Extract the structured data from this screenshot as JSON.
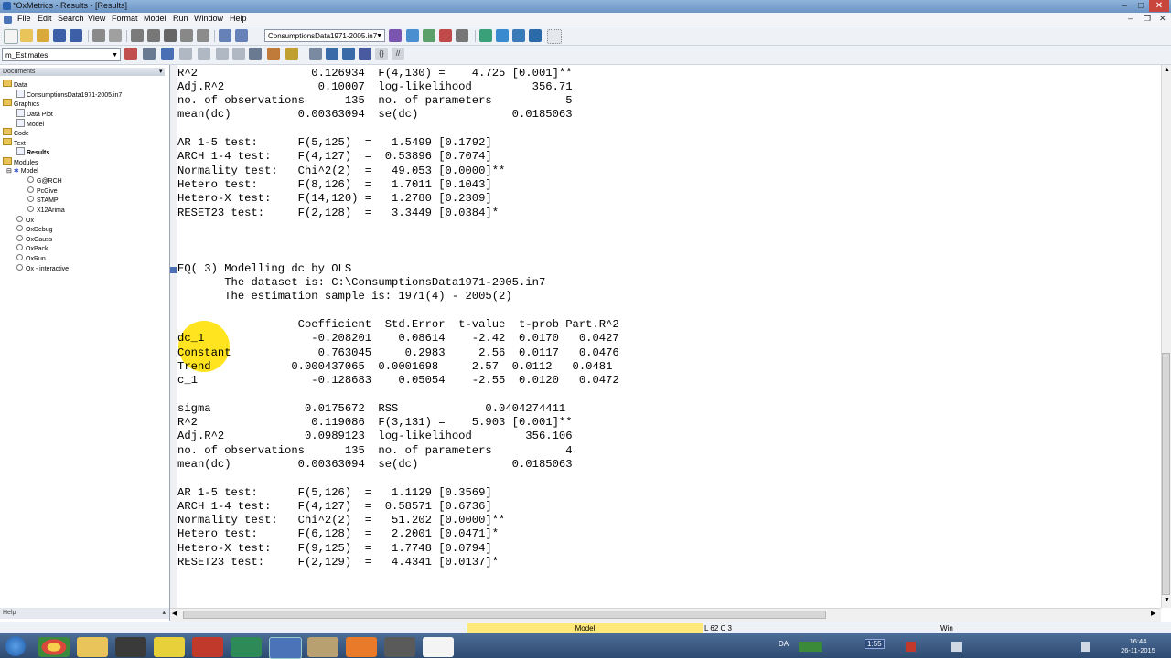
{
  "window": {
    "title": "*OxMetrics - Results - [Results]"
  },
  "menu": [
    "File",
    "Edit",
    "Search",
    "View",
    "Format",
    "Model",
    "Run",
    "Window",
    "Help"
  ],
  "toolbar": {
    "database_combo": "ConsumptionsData1971-2005.in7",
    "module_combo": "m_Estimates"
  },
  "sidebar": {
    "header": "Documents",
    "items": [
      {
        "label": "Data",
        "level": 0,
        "kind": "folder"
      },
      {
        "label": "ConsumptionsData1971-2005.in7",
        "level": 1,
        "kind": "file"
      },
      {
        "label": "Graphics",
        "level": 0,
        "kind": "folder"
      },
      {
        "label": "Data Plot",
        "level": 1,
        "kind": "file"
      },
      {
        "label": "Model",
        "level": 1,
        "kind": "file"
      },
      {
        "label": "Code",
        "level": 0,
        "kind": "folder"
      },
      {
        "label": "Text",
        "level": 0,
        "kind": "folder"
      },
      {
        "label": "Results",
        "level": 1,
        "kind": "file-bold"
      },
      {
        "label": "Modules",
        "level": 0,
        "kind": "folder"
      },
      {
        "label": "Model",
        "level": 1,
        "kind": "module"
      },
      {
        "label": "G@RCH",
        "level": 2,
        "kind": "sub"
      },
      {
        "label": "PcGive",
        "level": 2,
        "kind": "sub"
      },
      {
        "label": "STAMP",
        "level": 2,
        "kind": "sub"
      },
      {
        "label": "X12Arima",
        "level": 2,
        "kind": "sub"
      },
      {
        "label": "Ox",
        "level": 1,
        "kind": "sub"
      },
      {
        "label": "OxDebug",
        "level": 1,
        "kind": "sub"
      },
      {
        "label": "OxGauss",
        "level": 1,
        "kind": "sub"
      },
      {
        "label": "OxPack",
        "level": 1,
        "kind": "sub"
      },
      {
        "label": "OxRun",
        "level": 1,
        "kind": "sub"
      },
      {
        "label": "Ox - interactive",
        "level": 1,
        "kind": "sub"
      }
    ],
    "help": "Help"
  },
  "results": {
    "lines": [
      "R^2                 0.126934  F(4,130) =    4.725 [0.001]**",
      "Adj.R^2              0.10007  log-likelihood         356.71",
      "no. of observations      135  no. of parameters           5",
      "mean(dc)          0.00363094  se(dc)              0.0185063",
      "",
      "AR 1-5 test:      F(5,125)  =   1.5499 [0.1792]",
      "ARCH 1-4 test:    F(4,127)  =  0.53896 [0.7074]",
      "Normality test:   Chi^2(2)  =   49.053 [0.0000]**",
      "Hetero test:      F(8,126)  =   1.7011 [0.1043]",
      "Hetero-X test:    F(14,120) =   1.2780 [0.2309]",
      "RESET23 test:     F(2,128)  =   3.3449 [0.0384]*",
      "",
      "",
      "",
      "EQ( 3) Modelling dc by OLS",
      "       The dataset is: C:\\ConsumptionsData1971-2005.in7",
      "       The estimation sample is: 1971(4) - 2005(2)",
      "",
      "                  Coefficient  Std.Error  t-value  t-prob Part.R^2",
      "dc_1                -0.208201    0.08614    -2.42  0.0170   0.0427",
      "Constant             0.763045     0.2983     2.56  0.0117   0.0476",
      "Trend            0.000437065  0.0001698     2.57  0.0112   0.0481",
      "c_1                 -0.128683    0.05054    -2.55  0.0120   0.0472",
      "",
      "sigma              0.0175672  RSS             0.0404274411",
      "R^2                 0.119086  F(3,131) =    5.903 [0.001]**",
      "Adj.R^2            0.0989123  log-likelihood        356.106",
      "no. of observations      135  no. of parameters           4",
      "mean(dc)          0.00363094  se(dc)              0.0185063",
      "",
      "AR 1-5 test:      F(5,126)  =   1.1129 [0.3569]",
      "ARCH 1-4 test:    F(4,127)  =  0.58571 [0.6736]",
      "Normality test:   Chi^2(2)  =   51.202 [0.0000]**",
      "Hetero test:      F(6,128)  =   2.2001 [0.0471]*",
      "Hetero-X test:    F(9,125)  =   1.7748 [0.0794]",
      "RESET23 test:     F(2,129)  =   4.4341 [0.0137]*"
    ]
  },
  "status": {
    "mode": "Model",
    "position": "L 62 C 3",
    "window": "Win"
  },
  "taskbar": {
    "lang": "DA",
    "tray_time_box": "1:55",
    "clock_time": "16:44",
    "clock_date": "26-11-2015"
  }
}
